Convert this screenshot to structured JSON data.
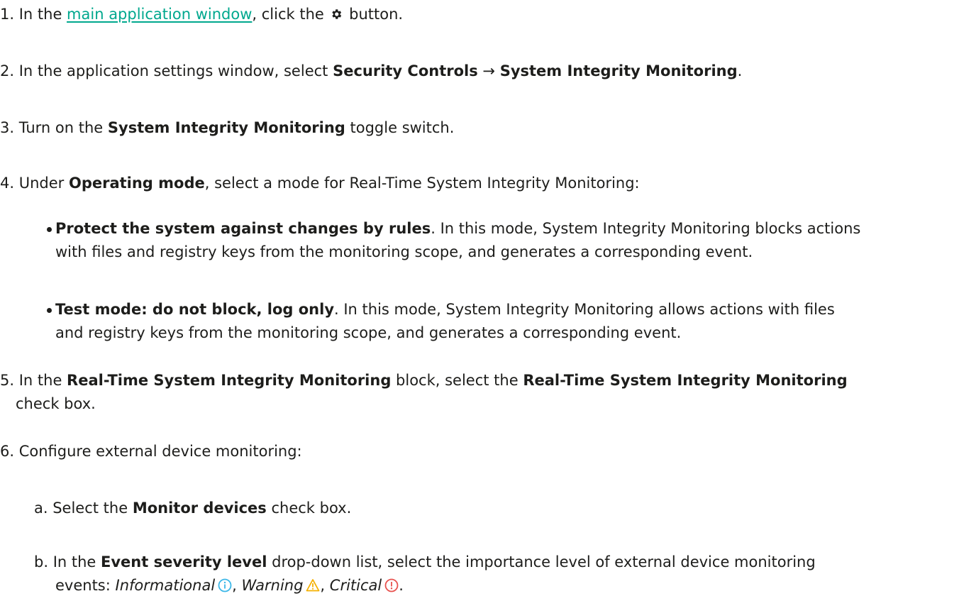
{
  "steps": [
    {
      "num": "1.",
      "before_link": " In the ",
      "link": "main application window",
      "after_link": ", click the ",
      "icon": "gear-icon",
      "end": " button."
    },
    {
      "num": "2.",
      "before": " In the application settings window, select ",
      "bold1": "Security Controls",
      "arrow": " → ",
      "bold2": "System Integrity Monitoring",
      "end": "."
    },
    {
      "num": "3.",
      "before": " Turn on the ",
      "bold": "System Integrity Monitoring",
      "end": " toggle switch."
    },
    {
      "num": "4.",
      "before": " Under ",
      "bold": "Operating mode",
      "end": ", select a mode for Real-Time System Integrity Monitoring:",
      "bullets": [
        {
          "bold": "Protect the system against changes by rules",
          "line1": ". In this mode, System Integrity Monitoring blocks actions",
          "line2": "with files and registry keys from the monitoring scope, and generates a corresponding event."
        },
        {
          "bold": "Test mode: do not block, log only",
          "line1": ". In this mode, System Integrity Monitoring allows actions with files",
          "line2": "and registry keys from the monitoring scope, and generates a corresponding event."
        }
      ]
    },
    {
      "num": "5.",
      "before": " In the ",
      "bold1": "Real-Time System Integrity Monitoring",
      "middle": " block, select the ",
      "bold2": "Real-Time System Integrity Monitoring",
      "line2": "check box."
    },
    {
      "num": "6.",
      "text": " Configure external device monitoring:",
      "substeps": [
        {
          "letter": "a.",
          "before": " Select the ",
          "bold": "Monitor devices",
          "end": " check box."
        },
        {
          "letter": "b.",
          "before": " In the ",
          "bold": "Event severity level",
          "line1_end": " drop-down list, select the importance level of external device monitoring",
          "line2_start": "events: ",
          "levels": [
            {
              "label": "Informational",
              "icon": "info-icon",
              "color": "#3bb7e8"
            },
            {
              "label": "Warning",
              "icon": "warning-icon",
              "color": "#f5b100"
            },
            {
              "label": "Critical",
              "icon": "critical-icon",
              "color": "#e8514e"
            }
          ],
          "sep": ", ",
          "end": "."
        }
      ]
    }
  ]
}
